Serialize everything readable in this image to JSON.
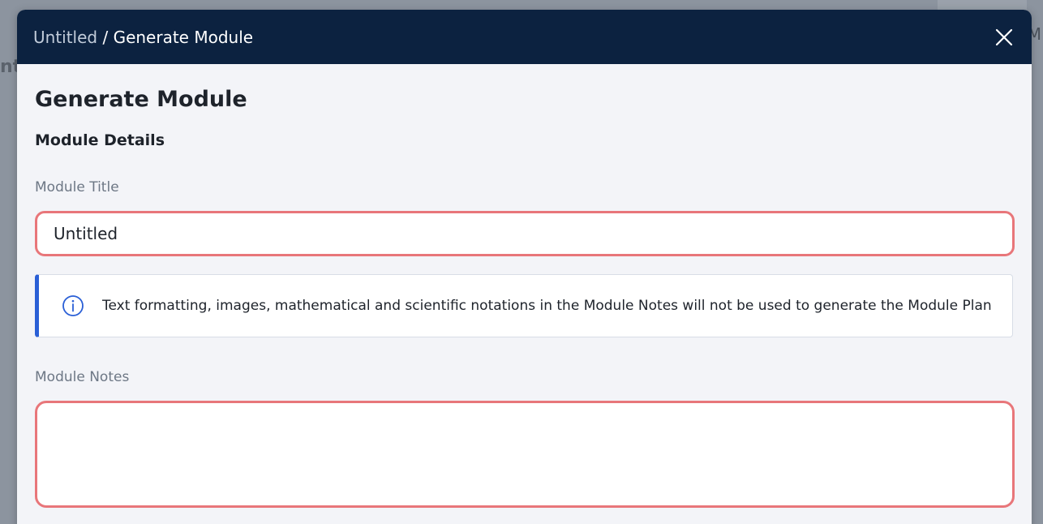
{
  "header": {
    "breadcrumb_parent": "Untitled",
    "breadcrumb_separator": " / ",
    "breadcrumb_current": "Generate Module",
    "close_icon": "close-icon"
  },
  "modal": {
    "title": "Generate Module",
    "section_title": "Module Details"
  },
  "form": {
    "title_label": "Module Title",
    "title_value": "Untitled",
    "info_text": "Text formatting, images, mathematical and scientific notations in the Module Notes will not be used to generate the Module Plan",
    "info_icon": "info-icon",
    "notes_label": "Module Notes",
    "notes_value": ""
  },
  "background": {
    "left_glyph": "nt",
    "right_glyph": "M"
  },
  "colors": {
    "header_bg": "#0c2240",
    "error_border": "#e8767a",
    "info_accent": "#2a5fd6",
    "modal_bg": "#f3f4f8"
  }
}
